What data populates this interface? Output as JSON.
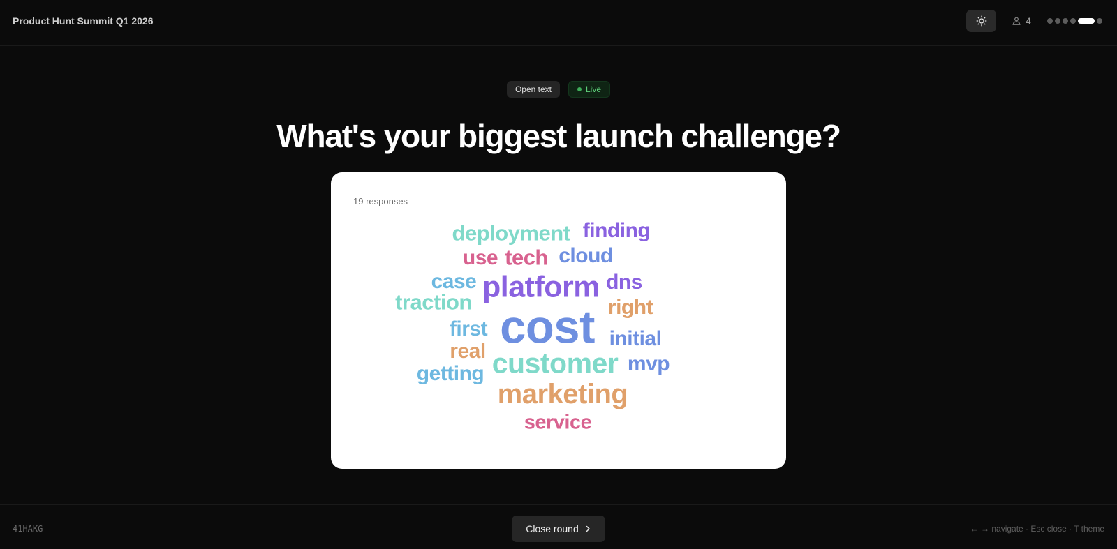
{
  "header": {
    "event_title": "Product Hunt Summit Q1 2026",
    "theme_toggle_icon": "sun-icon",
    "participant_icon": "participants-icon",
    "participant_count": "4",
    "progress": {
      "total_slides": 6,
      "current_slide": 5
    }
  },
  "question": {
    "type_label": "Open text",
    "status_label": "Live",
    "status_color": "#5fd07a",
    "text": "What's your biggest launch challenge?"
  },
  "wordcloud": {
    "responses_label": "19 responses",
    "palette": {
      "teal": "#7fd9c9",
      "purple": "#8a62e0",
      "pink": "#d8628f",
      "blue": "#6e8fe0",
      "skyblue": "#6db8e0",
      "orange": "#e0a06a"
    },
    "words": [
      {
        "text": "deployment",
        "color": "#7fd9c9"
      },
      {
        "text": "finding",
        "color": "#8a62e0"
      },
      {
        "text": "use",
        "color": "#d8628f"
      },
      {
        "text": "tech",
        "color": "#d8628f"
      },
      {
        "text": "cloud",
        "color": "#6e8fe0"
      },
      {
        "text": "case",
        "color": "#6db8e0"
      },
      {
        "text": "platform",
        "color": "#8a62e0"
      },
      {
        "text": "dns",
        "color": "#8a62e0"
      },
      {
        "text": "traction",
        "color": "#7fd9c9"
      },
      {
        "text": "right",
        "color": "#e0a06a"
      },
      {
        "text": "first",
        "color": "#6db8e0"
      },
      {
        "text": "cost",
        "color": "#6e8fe0"
      },
      {
        "text": "initial",
        "color": "#6e8fe0"
      },
      {
        "text": "real",
        "color": "#e0a06a"
      },
      {
        "text": "customer",
        "color": "#7fd9c9"
      },
      {
        "text": "mvp",
        "color": "#6e8fe0"
      },
      {
        "text": "getting",
        "color": "#6db8e0"
      },
      {
        "text": "marketing",
        "color": "#e0a06a"
      },
      {
        "text": "service",
        "color": "#d8628f"
      }
    ]
  },
  "footer": {
    "room_code": "41HAKG",
    "close_round_label": "Close round",
    "close_round_icon": "chevron-right-icon",
    "shortcuts_hint": "← → navigate · Esc close · T theme"
  }
}
